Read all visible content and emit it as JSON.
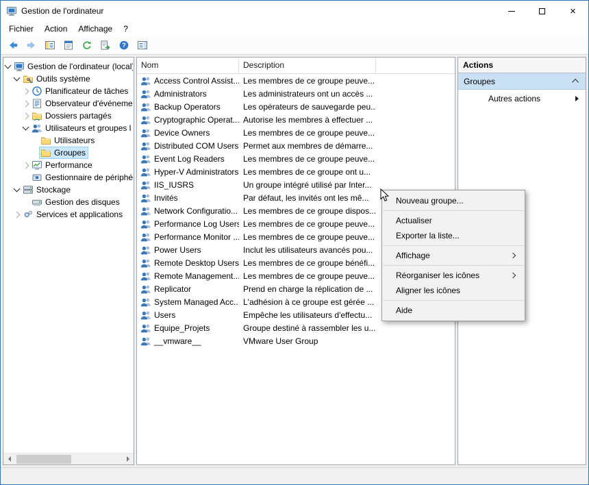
{
  "window": {
    "title": "Gestion de l'ordinateur"
  },
  "menubar": {
    "items": [
      "Fichier",
      "Action",
      "Affichage",
      "?"
    ]
  },
  "toolbar": {
    "buttons": [
      {
        "name": "back",
        "icon": "arrow-left"
      },
      {
        "name": "forward",
        "icon": "arrow-right"
      },
      {
        "name": "show-hide-console-tree",
        "icon": "window-tree"
      },
      {
        "name": "properties",
        "icon": "doc-props"
      },
      {
        "name": "refresh",
        "icon": "refresh"
      },
      {
        "name": "export-list",
        "icon": "export"
      },
      {
        "name": "help",
        "icon": "help"
      },
      {
        "name": "show-hide-action-pane",
        "icon": "action-pane"
      }
    ]
  },
  "tree": {
    "items": [
      {
        "label": "Gestion de l'ordinateur (local)",
        "level": 0,
        "state": "expanded",
        "icon": "computer",
        "selected": false
      },
      {
        "label": "Outils système",
        "level": 1,
        "state": "expanded",
        "icon": "folder-tools",
        "selected": false
      },
      {
        "label": "Planificateur de tâches",
        "level": 2,
        "state": "collapsed",
        "icon": "clock",
        "selected": false
      },
      {
        "label": "Observateur d'événeme",
        "level": 2,
        "state": "collapsed",
        "icon": "event",
        "selected": false
      },
      {
        "label": "Dossiers partagés",
        "level": 2,
        "state": "collapsed",
        "icon": "shared-folder",
        "selected": false
      },
      {
        "label": "Utilisateurs et groupes l",
        "level": 2,
        "state": "expanded",
        "icon": "users",
        "selected": false
      },
      {
        "label": "Utilisateurs",
        "level": 3,
        "state": "leaf",
        "icon": "folder",
        "selected": false
      },
      {
        "label": "Groupes",
        "level": 3,
        "state": "leaf",
        "icon": "folder",
        "selected": true
      },
      {
        "label": "Performance",
        "level": 2,
        "state": "collapsed",
        "icon": "perf",
        "selected": false
      },
      {
        "label": "Gestionnaire de périphé",
        "level": 2,
        "state": "leaf",
        "icon": "device",
        "selected": false
      },
      {
        "label": "Stockage",
        "level": 1,
        "state": "expanded",
        "icon": "storage",
        "selected": false
      },
      {
        "label": "Gestion des disques",
        "level": 2,
        "state": "leaf",
        "icon": "disk",
        "selected": false
      },
      {
        "label": "Services et applications",
        "level": 1,
        "state": "collapsed",
        "icon": "services",
        "selected": false
      }
    ]
  },
  "list": {
    "columns": [
      "Nom",
      "Description"
    ],
    "rows": [
      {
        "name": "Access Control Assist...",
        "description": "Les membres de ce groupe peuve..."
      },
      {
        "name": "Administrators",
        "description": "Les administrateurs ont un accès ..."
      },
      {
        "name": "Backup Operators",
        "description": "Les opérateurs de sauvegarde peu..."
      },
      {
        "name": "Cryptographic Operat...",
        "description": "Autorise les membres à effectuer ..."
      },
      {
        "name": "Device Owners",
        "description": "Les membres de ce groupe peuve..."
      },
      {
        "name": "Distributed COM Users",
        "description": "Permet aux membres de démarre..."
      },
      {
        "name": "Event Log Readers",
        "description": "Les membres de ce groupe peuve..."
      },
      {
        "name": "Hyper-V Administrators",
        "description": "Les membres de ce groupe ont u..."
      },
      {
        "name": "IIS_IUSRS",
        "description": "Un groupe intégré utilisé par Inter..."
      },
      {
        "name": "Invités",
        "description": "Par défaut, les invités ont les mê..."
      },
      {
        "name": "Network Configuratio...",
        "description": "Les membres de ce groupe dispos..."
      },
      {
        "name": "Performance Log Users",
        "description": "Les membres de ce groupe peuve..."
      },
      {
        "name": "Performance Monitor ...",
        "description": "Les membres de ce groupe peuve..."
      },
      {
        "name": "Power Users",
        "description": "Inclut les utilisateurs avancés pou..."
      },
      {
        "name": "Remote Desktop Users",
        "description": "Les membres de ce groupe bénéfi..."
      },
      {
        "name": "Remote Management...",
        "description": "Les membres de ce groupe peuve..."
      },
      {
        "name": "Replicator",
        "description": "Prend en charge la réplication de ..."
      },
      {
        "name": "System Managed Acc...",
        "description": "L'adhésion à ce groupe est gérée ..."
      },
      {
        "name": "Users",
        "description": "Empêche les utilisateurs d'effectu..."
      },
      {
        "name": "Equipe_Projets",
        "description": "Groupe destiné à rassembler les u..."
      },
      {
        "name": "__vmware__",
        "description": "VMware User Group"
      }
    ]
  },
  "context_menu": {
    "items": [
      {
        "type": "item",
        "label": "Nouveau groupe...",
        "submenu": false
      },
      {
        "type": "separator"
      },
      {
        "type": "item",
        "label": "Actualiser",
        "submenu": false
      },
      {
        "type": "item",
        "label": "Exporter la liste...",
        "submenu": false
      },
      {
        "type": "separator"
      },
      {
        "type": "item",
        "label": "Affichage",
        "submenu": true
      },
      {
        "type": "separator"
      },
      {
        "type": "item",
        "label": "Réorganiser les icônes",
        "submenu": true
      },
      {
        "type": "item",
        "label": "Aligner les icônes",
        "submenu": false
      },
      {
        "type": "separator"
      },
      {
        "type": "item",
        "label": "Aide",
        "submenu": false
      }
    ]
  },
  "actions_pane": {
    "title": "Actions",
    "section_label": "Groupes",
    "more_label": "Autres actions"
  }
}
